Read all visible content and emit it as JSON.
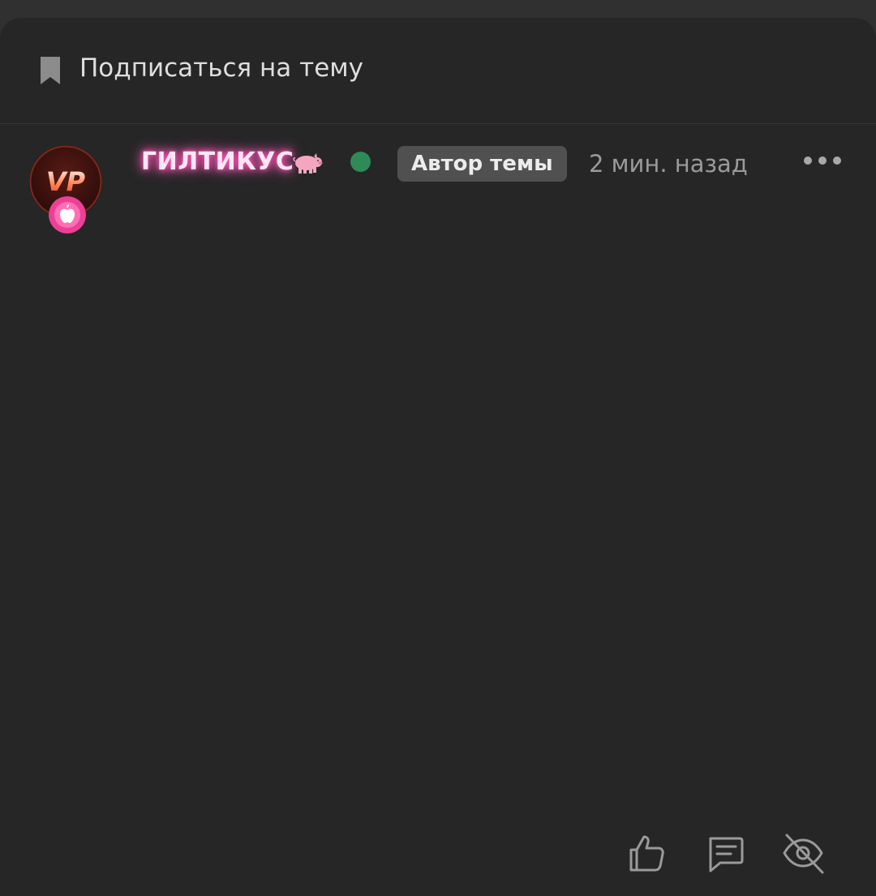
{
  "subscribe": {
    "label": "Подписаться на тему",
    "icon": "bookmark-icon"
  },
  "post": {
    "avatar_text": "VP",
    "username": "ГИЛТИКУС",
    "username_glow_color": "#ff4fb3",
    "username_icon": "pig-icon",
    "online_status_color": "#2e8b57",
    "author_badge": "Автор темы",
    "timestamp": "2 мин. назад"
  },
  "actions": [
    {
      "icon": "like-icon"
    },
    {
      "icon": "reply-icon"
    },
    {
      "icon": "hide-icon"
    }
  ],
  "colors": {
    "background": "#262626",
    "text": "#dedede",
    "muted": "#9a9a9a",
    "badge_background": "#505050"
  }
}
